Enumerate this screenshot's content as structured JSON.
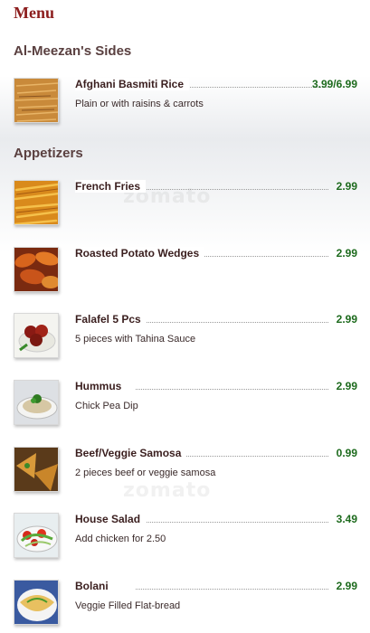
{
  "page_title": "Menu",
  "sections": [
    {
      "title": "Al-Meezan's Sides",
      "items": [
        {
          "name": "Afghani Basmiti Rice",
          "price": "3.99/6.99",
          "description": "Plain or with raisins & carrots"
        }
      ]
    },
    {
      "title": "Appetizers",
      "items": [
        {
          "name": "French Fries",
          "price": "2.99",
          "description": ""
        },
        {
          "name": "Roasted Potato Wedges",
          "price": "2.99",
          "description": ""
        },
        {
          "name": "Falafel 5 Pcs",
          "price": "2.99",
          "description": " 5 pieces with Tahina Sauce"
        },
        {
          "name": "Hummus",
          "price": "2.99",
          "description": " Chick Pea Dip"
        },
        {
          "name": "Beef/Veggie Samosa",
          "price": "0.99",
          "description": " 2 pieces beef or veggie samosa"
        },
        {
          "name": "House Salad",
          "price": "3.49",
          "description": "Add chicken for 2.50"
        },
        {
          "name": "Bolani",
          "price": "2.99",
          "description": " Veggie Filled Flat-bread"
        }
      ]
    }
  ],
  "watermark_text": "zomato"
}
